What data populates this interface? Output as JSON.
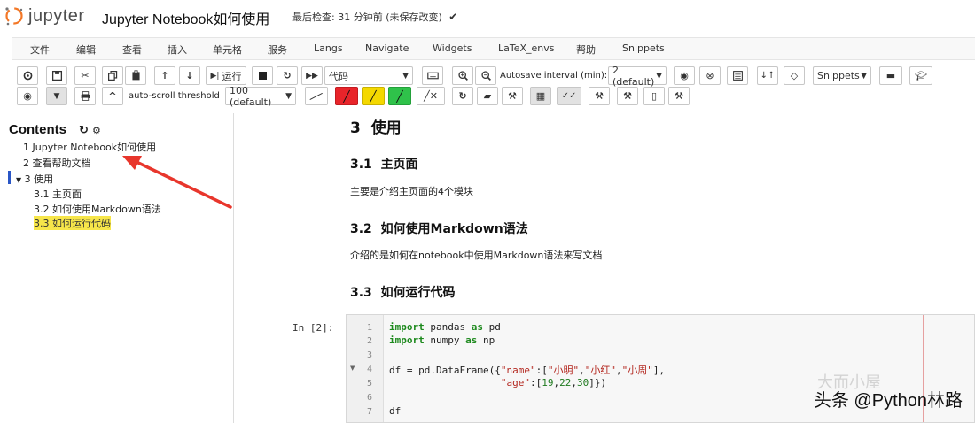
{
  "header": {
    "logo_text": "jupyter",
    "title": "Jupyter Notebook如何使用",
    "checkpoint": "最后检查: 31 分钟前",
    "autosave": "(未保存改变)"
  },
  "menu": [
    "文件",
    "编辑",
    "查看",
    "插入",
    "单元格",
    "服务",
    "Langs",
    "Navigate",
    "Widgets",
    "LaTeX_envs",
    "帮助",
    "Snippets"
  ],
  "toolbar": {
    "run_label": "运行",
    "cell_type": "代码",
    "autoscroll_label": "auto-scroll threshold",
    "autoscroll_value": "100 (default)",
    "interval_label": "Autosave interval (min):",
    "interval_value": "2 (default)",
    "snippets_value": "Snippets"
  },
  "toc": {
    "title": "Contents",
    "items": [
      {
        "num": "1",
        "text": "Jupyter Notebook如何使用"
      },
      {
        "num": "2",
        "text": "查看帮助文档"
      },
      {
        "num": "3",
        "text": "使用"
      },
      {
        "num": "3.1",
        "text": "主页面"
      },
      {
        "num": "3.2",
        "text": "如何使用Markdown语法"
      },
      {
        "num": "3.3",
        "text": "如何运行代码"
      }
    ]
  },
  "content": {
    "h_use": {
      "num": "3",
      "text": "使用"
    },
    "h31": {
      "num": "3.1",
      "text": "主页面"
    },
    "p31": "主要是介绍主页面的4个模块",
    "h32": {
      "num": "3.2",
      "text": "如何使用Markdown语法"
    },
    "p32": "介绍的是如何在notebook中使用Markdown语法来写文档",
    "h33": {
      "num": "3.3",
      "text": "如何运行代码"
    }
  },
  "cell": {
    "prompt": "In [2]:",
    "line_numbers": [
      "1",
      "2",
      "3",
      "4",
      "5",
      "6",
      "7"
    ]
  },
  "watermark": {
    "text": "头条 @Python林路",
    "faint": "大而小屋"
  },
  "colors": {
    "accent": "#2a56c6",
    "highlight": "#f7e64a",
    "arrow": "#e8362c"
  }
}
